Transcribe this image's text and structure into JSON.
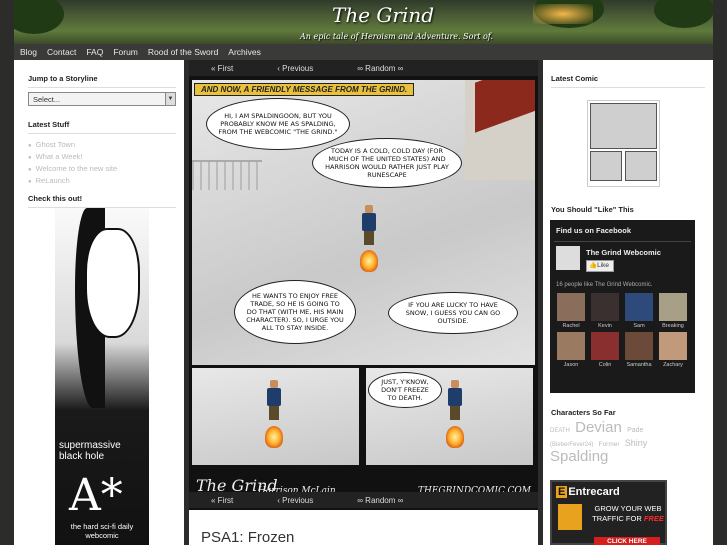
{
  "header": {
    "title": "The Grind",
    "tagline": "An epic tale of Heroism and Adventure. Sort of."
  },
  "nav": {
    "items": [
      "Blog",
      "Contact",
      "FAQ",
      "Forum",
      "Rood of the Sword",
      "Archives"
    ]
  },
  "left_sidebar": {
    "storyline_title": "Jump to a Storyline",
    "storyline_select": "Select...",
    "latest_title": "Latest Stuff",
    "latest_items": [
      "Ghost Town",
      "What a Week!",
      "Welcome to the new site",
      "ReLaunch"
    ],
    "checkout_title": "Check this out!",
    "ad": {
      "line1": "supermassive black hole",
      "letter": "A*",
      "line2": "the hard sci-fi daily webcomic"
    }
  },
  "comic": {
    "nav": {
      "first": "« First",
      "previous": "‹ Previous",
      "random": "∞ Random ∞"
    },
    "banner": "AND NOW, A FRIENDLY MESSAGE FROM THE GRIND.",
    "bubble1": "HI, I AM SPALDINGOON, BUT YOU PROBABLY KNOW ME AS SPALDING, FROM THE WEBCOMIC \"THE GRIND.\"",
    "bubble2": "TODAY IS A COLD, COLD DAY (FOR MUCH OF THE UNITED STATES) AND HARRISON WOULD RATHER JUST PLAY RUNESCAPE",
    "bubble3": "HE WANTS TO ENJOY FREE TRADE, SO HE IS GOING TO DO THAT (WITH ME, HIS MAIN CHARACTER). SO, I URGE YOU ALL TO STAY INSIDE.",
    "bubble4": "IF YOU ARE LUCKY TO HAVE SNOW, I GUESS YOU CAN GO OUTSIDE.",
    "bubble5": "JUST, Y'KNOW, DON'T FREEZE TO DEATH.",
    "brand": "The Grind",
    "author": "Harrison McLain",
    "site": "THEGRINDCOMIC.COM",
    "post_title": "PSA1: Frozen"
  },
  "right_sidebar": {
    "latest_comic_title": "Latest Comic",
    "like_title": "You Should \"Like\" This",
    "fb": {
      "header": "Find us on Facebook",
      "page_name": "The Grind Webcomic",
      "like_btn": "Like",
      "count_text": "16 people like The Grind Webcomic.",
      "people": [
        "Rachel",
        "Kevin",
        "Sam",
        "Breaking",
        "Jason",
        "Colin",
        "Samantha",
        "Zachary"
      ]
    },
    "characters_title": "Characters So Far",
    "tags": [
      "DEATH",
      "Devian",
      "Pade",
      "(BieberFever24)",
      "Former",
      "Shiny",
      "Spalding"
    ],
    "entrecard": {
      "logo": "Entrecard",
      "text1": "GROW YOUR WEB TRAFFIC FOR",
      "free": "FREE",
      "click": "CLICK HERE"
    }
  }
}
